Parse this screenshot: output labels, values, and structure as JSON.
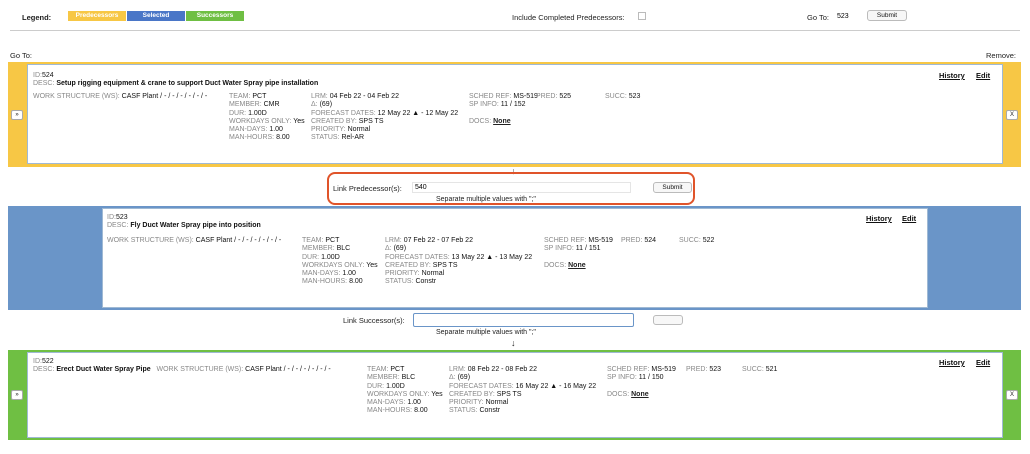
{
  "legend": {
    "title": "Legend:",
    "predecessors": "Predecessors",
    "selected": "Selected",
    "successors": "Successors",
    "colors": {
      "predecessors": "#f7c745",
      "selected": "#4a76c7",
      "successors": "#6fbf43",
      "highlight": "#e0542a"
    }
  },
  "include_completed": "Include Completed Predecessors:",
  "goto_top": {
    "label": "Go To:",
    "value": "523",
    "submit": "Submit"
  },
  "goto_left": "Go To:",
  "remove_label": "Remove:",
  "side_btn_expand": "»",
  "side_btn_remove": "X",
  "arrow": "↓",
  "predecessor_card": {
    "id_label": "ID:",
    "id": "524",
    "desc_label": "DESC:",
    "desc": "Setup rigging equipment & crane to support Duct Water Spray pipe installation",
    "ws_label": "WORK STRUCTURE (WS):",
    "ws": "CASF Plant / - / - / - / - / - / -",
    "team_label": "TEAM:",
    "team": "PCT",
    "member_label": "MEMBER:",
    "member": "CMR",
    "dur_label": "DUR:",
    "dur": "1.00D",
    "workdays_label": "WORKDAYS ONLY:",
    "workdays": "Yes",
    "mandays_label": "MAN-DAYS:",
    "mandays": "1.00",
    "manhours_label": "MAN-HOURS:",
    "manhours": "8.00",
    "lrm_label": "LRM:",
    "lrm": "04 Feb 22 - 04 Feb 22",
    "delta_label": "Δ:",
    "delta": "(69)",
    "forecast_label": "FORECAST DATES:",
    "forecast": "12 May 22 ▲ - 12 May 22",
    "created_label": "CREATED BY:",
    "created": "SPS TS",
    "priority_label": "PRIORITY:",
    "priority": "Normal",
    "status_label": "STATUS:",
    "status": "Rel-AR",
    "schedref_label": "SCHED REF:",
    "schedref": "MS-519",
    "pred_label": "PRED:",
    "pred": "525",
    "succ_label": "SUCC:",
    "succ": "523",
    "spinfo_label": "SP INFO:",
    "spinfo": "11 / 152",
    "docs_label": "DOCS:",
    "docs": "None",
    "history": "History",
    "edit": "Edit"
  },
  "link_predecessor": {
    "label": "Link Predecessor(s):",
    "value": "540",
    "submit": "Submit",
    "hint": "Separate multiple values with \";\""
  },
  "selected_card": {
    "id_label": "ID:",
    "id": "523",
    "desc_label": "DESC:",
    "desc": "Fly Duct Water Spray pipe into position",
    "ws_label": "WORK STRUCTURE (WS):",
    "ws": "CASF Plant / - / - / - / - / - / -",
    "team_label": "TEAM:",
    "team": "PCT",
    "member_label": "MEMBER:",
    "member": "BLC",
    "dur_label": "DUR:",
    "dur": "1.00D",
    "workdays_label": "WORKDAYS ONLY:",
    "workdays": "Yes",
    "mandays_label": "MAN-DAYS:",
    "mandays": "1.00",
    "manhours_label": "MAN-HOURS:",
    "manhours": "8.00",
    "lrm_label": "LRM:",
    "lrm": "07 Feb 22 - 07 Feb 22",
    "delta_label": "Δ:",
    "delta": "(69)",
    "forecast_label": "FORECAST DATES:",
    "forecast": "13 May 22 ▲ - 13 May 22",
    "created_label": "CREATED BY:",
    "created": "SPS TS",
    "priority_label": "PRIORITY:",
    "priority": "Normal",
    "status_label": "STATUS:",
    "status": "Constr",
    "schedref_label": "SCHED REF:",
    "schedref": "MS-519",
    "pred_label": "PRED:",
    "pred": "524",
    "succ_label": "SUCC:",
    "succ": "522",
    "spinfo_label": "SP INFO:",
    "spinfo": "11 / 151",
    "docs_label": "DOCS:",
    "docs": "None",
    "history": "History",
    "edit": "Edit"
  },
  "link_successor": {
    "label": "Link Successor(s):",
    "value": "",
    "hint": "Separate multiple values with \";\""
  },
  "successor_card": {
    "id_label": "ID:",
    "id": "522",
    "desc_label": "DESC:",
    "desc": "Erect Duct Water Spray Pipe",
    "ws_label": "WORK STRUCTURE (WS):",
    "ws": "CASF Plant / - / - / - / - / - / -",
    "team_label": "TEAM:",
    "team": "PCT",
    "member_label": "MEMBER:",
    "member": "BLC",
    "dur_label": "DUR:",
    "dur": "1.00D",
    "workdays_label": "WORKDAYS ONLY:",
    "workdays": "Yes",
    "mandays_label": "MAN-DAYS:",
    "mandays": "1.00",
    "manhours_label": "MAN-HOURS:",
    "manhours": "8.00",
    "lrm_label": "LRM:",
    "lrm": "08 Feb 22 - 08 Feb 22",
    "delta_label": "Δ:",
    "delta": "(69)",
    "forecast_label": "FORECAST DATES:",
    "forecast": "16 May 22 ▲ - 16 May 22",
    "created_label": "CREATED BY:",
    "created": "SPS TS",
    "priority_label": "PRIORITY:",
    "priority": "Normal",
    "status_label": "STATUS:",
    "status": "Constr",
    "schedref_label": "SCHED REF:",
    "schedref": "MS-519",
    "pred_label": "PRED:",
    "pred": "523",
    "succ_label": "SUCC:",
    "succ": "521",
    "spinfo_label": "SP INFO:",
    "spinfo": "11 / 150",
    "docs_label": "DOCS:",
    "docs": "None",
    "history": "History",
    "edit": "Edit"
  }
}
